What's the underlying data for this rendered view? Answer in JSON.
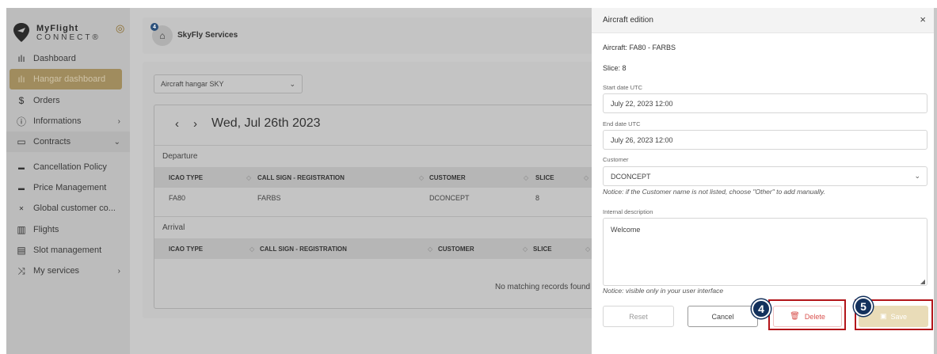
{
  "sidebar": {
    "logo": {
      "name": "MyFlight",
      "sub": "CONNECT",
      "mark": "®"
    },
    "items": [
      {
        "label": "Dashboard",
        "icon": "bar-chart-icon"
      },
      {
        "label": "Hangar dashboard",
        "icon": "bar-chart-icon"
      },
      {
        "label": "Orders",
        "icon": "dollar-icon"
      },
      {
        "label": "Informations",
        "icon": "info-icon"
      },
      {
        "label": "Contracts",
        "icon": "folder-icon"
      },
      {
        "label": "Cancellation Policy",
        "icon": "card-icon"
      },
      {
        "label": "Price Management",
        "icon": "card-icon"
      },
      {
        "label": "Global customer co...",
        "icon": "cross-icon"
      },
      {
        "label": "Flights",
        "icon": "luggage-icon"
      },
      {
        "label": "Slot management",
        "icon": "printer-icon"
      },
      {
        "label": "My services",
        "icon": "shuffle-icon"
      }
    ]
  },
  "topbar": {
    "badge": "4",
    "title": "SkyFly Services"
  },
  "main": {
    "hangar_select": "Aircraft hangar SKY",
    "date": "Wed, Jul 26th 2023",
    "departure": {
      "label": "Departure",
      "columns": [
        "ICAO TYPE",
        "CALL SIGN - REGISTRATION",
        "CUSTOMER",
        "SLICE"
      ],
      "rows": [
        [
          "FA80",
          "FARBS",
          "DCONCEPT",
          "8"
        ]
      ]
    },
    "arrival": {
      "label": "Arrival",
      "columns": [
        "ICAO TYPE",
        "CALL SIGN - REGISTRATION",
        "CUSTOMER",
        "SLICE"
      ],
      "empty_text": "No matching records found"
    }
  },
  "panel": {
    "title": "Aircraft edition",
    "close": "×",
    "aircraft": "Aircraft: FA80 - FARBS",
    "slice": "Slice: 8",
    "start_label": "Start date UTC",
    "start_value": "July 22, 2023 12:00",
    "end_label": "End date UTC",
    "end_value": "July 26, 2023 12:00",
    "customer_label": "Customer",
    "customer_value": "DCONCEPT",
    "customer_notice": "Notice: if the Customer name is not listed, choose \"Other\" to add manually.",
    "desc_label": "Internal description",
    "desc_value": "Welcome",
    "desc_notice": "Notice: visible only in your user interface",
    "buttons": {
      "reset": "Reset",
      "cancel": "Cancel",
      "delete": "Delete",
      "save": "Save"
    }
  },
  "annotations": {
    "step_delete": "4",
    "step_save": "5"
  },
  "colors": {
    "accent": "#a08c5e",
    "danger": "#d9534f",
    "highlight": "#b3151a",
    "step": "#13315c"
  }
}
